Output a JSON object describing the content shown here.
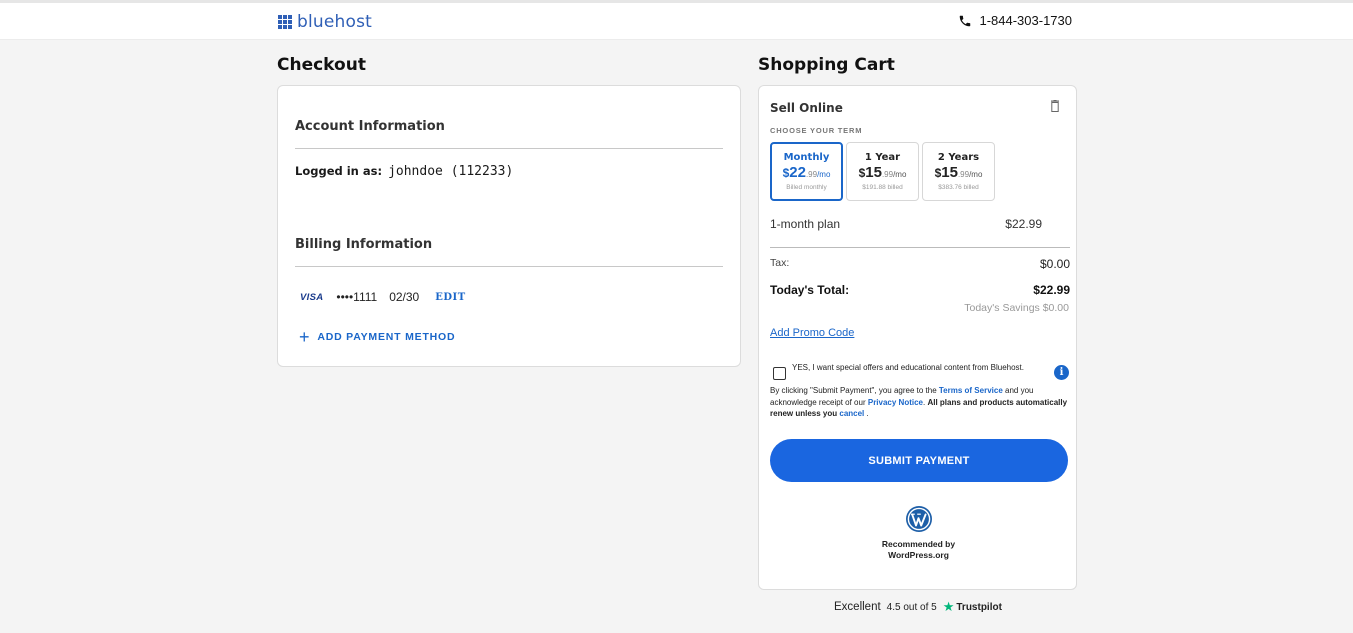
{
  "header": {
    "brand": "bluehost",
    "phone": "1-844-303-1730"
  },
  "checkout": {
    "title": "Checkout",
    "account_title": "Account Information",
    "logged_label": "Logged in as:",
    "logged_user": "johndoe (112233)",
    "billing_title": "Billing Information",
    "card_brand": "VISA",
    "card_masked": "••••1111",
    "card_exp": "02/30",
    "edit_label": "EDIT",
    "add_payment_label": "ADD PAYMENT METHOD"
  },
  "cart": {
    "title": "Shopping Cart",
    "product": "Sell Online",
    "term_label": "CHOOSE YOUR TERM",
    "terms": [
      {
        "name": "Monthly",
        "dollar": "$",
        "price": "22",
        "cents": ".99",
        "per": "/mo",
        "sub": "Billed monthly",
        "selected": true
      },
      {
        "name": "1 Year",
        "dollar": "$",
        "price": "15",
        "cents": ".99",
        "per": "/mo",
        "sub": "$191.88 billed",
        "selected": false
      },
      {
        "name": "2 Years",
        "dollar": "$",
        "price": "15",
        "cents": ".99",
        "per": "/mo",
        "sub": "$383.76 billed",
        "selected": false
      }
    ],
    "plan_label": "1-month plan",
    "plan_price": "$22.99",
    "tax_label": "Tax:",
    "tax_value": "$0.00",
    "total_label": "Today's Total:",
    "total_value": "$22.99",
    "savings": "Today's Savings $0.00",
    "promo_label": "Add Promo Code",
    "optin_text": "YES, I want special offers and educational content from Bluehost.",
    "info_glyph": "i",
    "legal": {
      "part1": "By clicking \"Submit Payment\", you agree to the",
      "tos": "Terms of Service",
      "part2": "and you acknowledge receipt of our",
      "privacy": "Privacy Notice",
      "part3": ". ",
      "bold": "All plans and products automatically renew unless you",
      "cancel": "cancel",
      "part4": "."
    },
    "submit_label": "SUBMIT PAYMENT",
    "wp_line1": "Recommended by",
    "wp_line2": "WordPress.org"
  },
  "trustpilot": {
    "rating_word": "Excellent",
    "score": "4.5 out of 5",
    "brand": "Trustpilot",
    "star": "★"
  },
  "colors": {
    "accent": "#1a66c9",
    "button": "#1a66e0",
    "brand": "#2f5fb6",
    "trustpilot": "#00b67a"
  }
}
